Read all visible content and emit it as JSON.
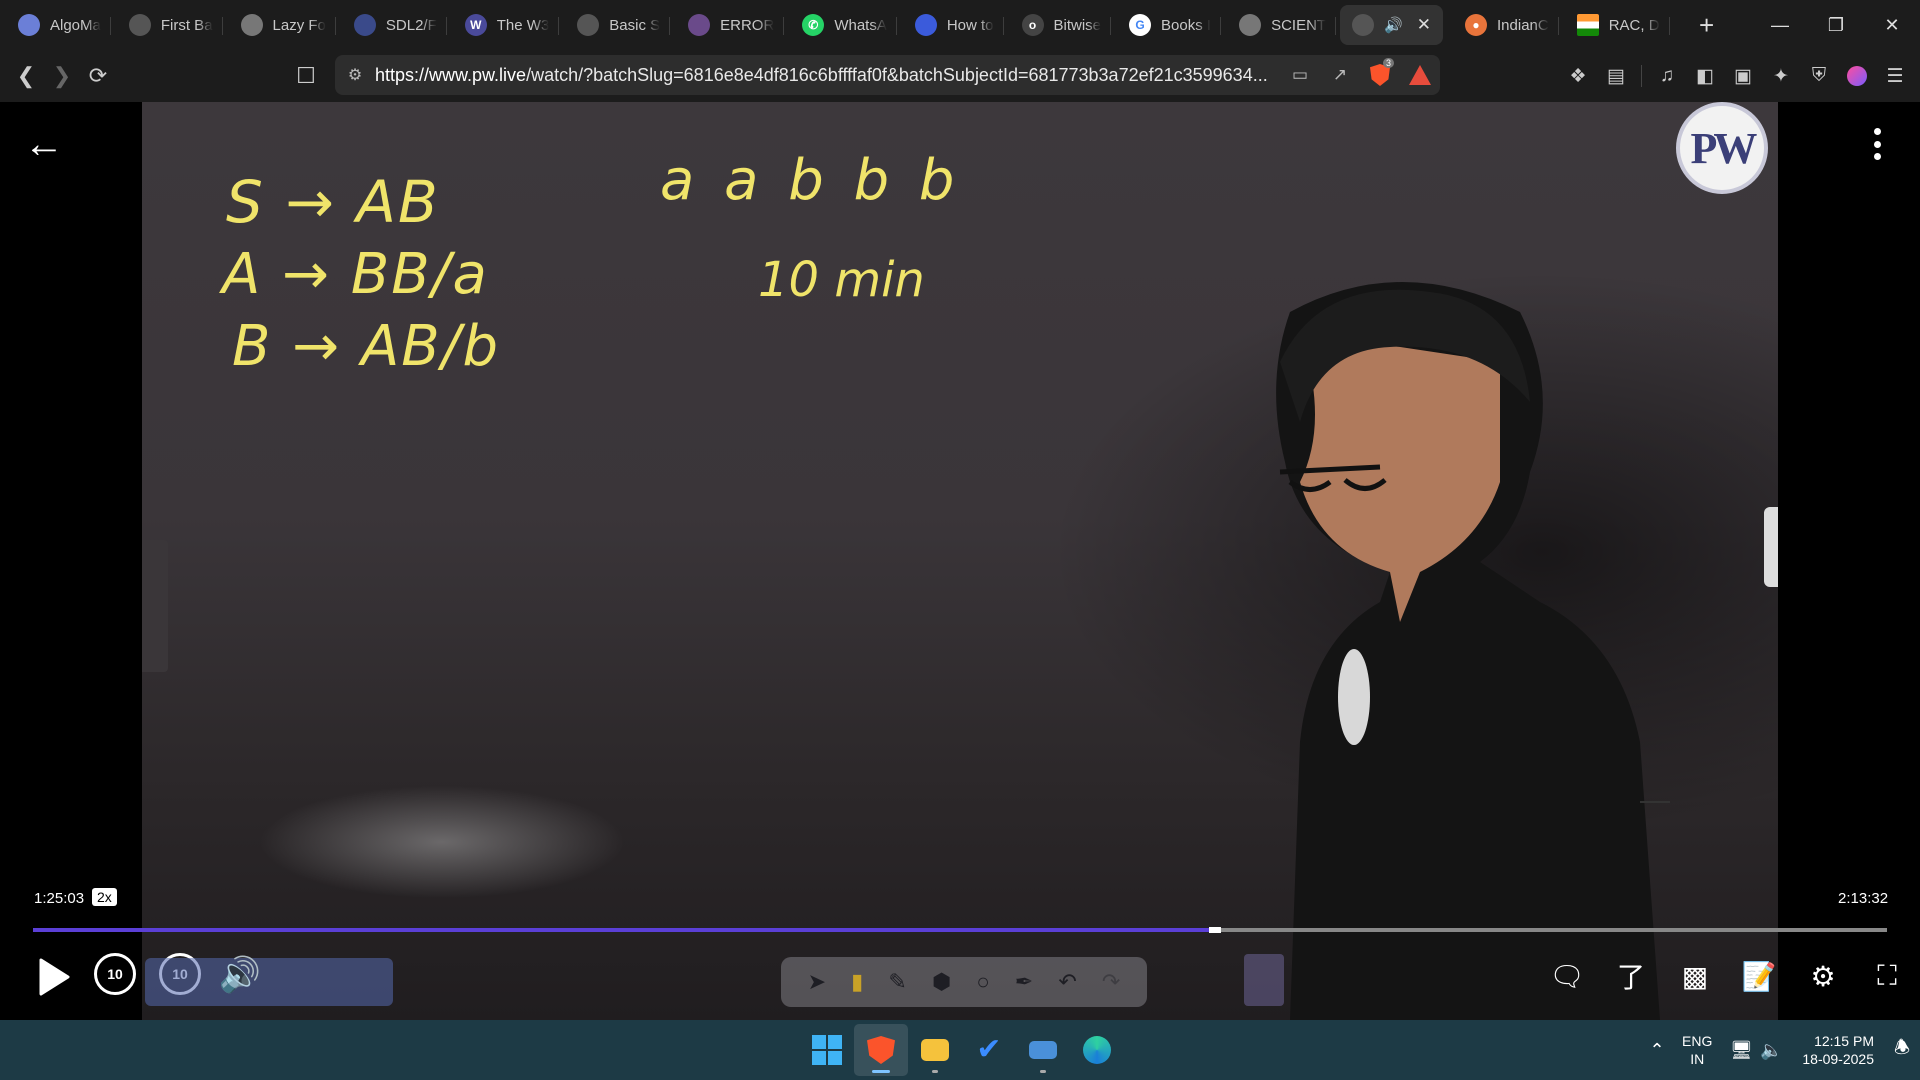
{
  "browser": {
    "tabs": [
      {
        "label": "AlgoMa",
        "icon": "algomaster-icon",
        "color": "#6b7fd7"
      },
      {
        "label": "First Ba",
        "icon": "first-bad-version-icon",
        "color": "#555555"
      },
      {
        "label": "Lazy Fo",
        "icon": "globe-icon",
        "color": "#777777"
      },
      {
        "label": "SDL2/F",
        "icon": "sdl-icon",
        "color": "#3a4a8a"
      },
      {
        "label": "The W3",
        "icon": "w3-icon",
        "color": "#4a4a9a"
      },
      {
        "label": "Basic S",
        "icon": "basic-syntax-icon",
        "color": "#555555"
      },
      {
        "label": "ERROR",
        "icon": "error-icon",
        "color": "#6a4a8a"
      },
      {
        "label": "WhatsA",
        "icon": "whatsapp-icon",
        "color": "#25d366"
      },
      {
        "label": "How to",
        "icon": "howto-icon",
        "color": "#3b5bdb"
      },
      {
        "label": "Bitwise",
        "icon": "orkut-icon",
        "color": "#444444"
      },
      {
        "label": "Books I",
        "icon": "google-icon",
        "color": "#ffffff"
      },
      {
        "label": "SCIENT",
        "icon": "globe-icon",
        "color": "#777777"
      },
      {
        "label": "IndianC",
        "icon": "indian-icon",
        "color": "#e8743b"
      },
      {
        "label": "RAC, D",
        "icon": "india-flag-icon",
        "color": "#ff9933"
      }
    ],
    "active_tab": {
      "icon": "pw-tab-icon",
      "audio_icon": "speaker-icon",
      "close_icon": "close-icon"
    },
    "new_tab_label": "+",
    "url_host": "https://www.pw.live",
    "url_rest": "/watch/?batchSlug=6816e8e4df816c6bffffaf0f&batchSubjectId=681773b3a72ef21c3599634...",
    "shield_badge": "3"
  },
  "player": {
    "board_text": {
      "rule_1": "S → AB",
      "rule_2": "A → BB/a",
      "rule_3": "B → AB/b",
      "input_string": "a a b b b",
      "timer": "10 min"
    },
    "logo_text": "PW",
    "elapsed": "1:25:03",
    "speed": "2x",
    "duration": "2:13:32",
    "progress": 0.6376,
    "rewind_label": "10",
    "forward_label": "10"
  },
  "taskbar": {
    "lang_line1": "ENG",
    "lang_line2": "IN",
    "time": "12:15 PM",
    "date": "18-09-2025"
  }
}
